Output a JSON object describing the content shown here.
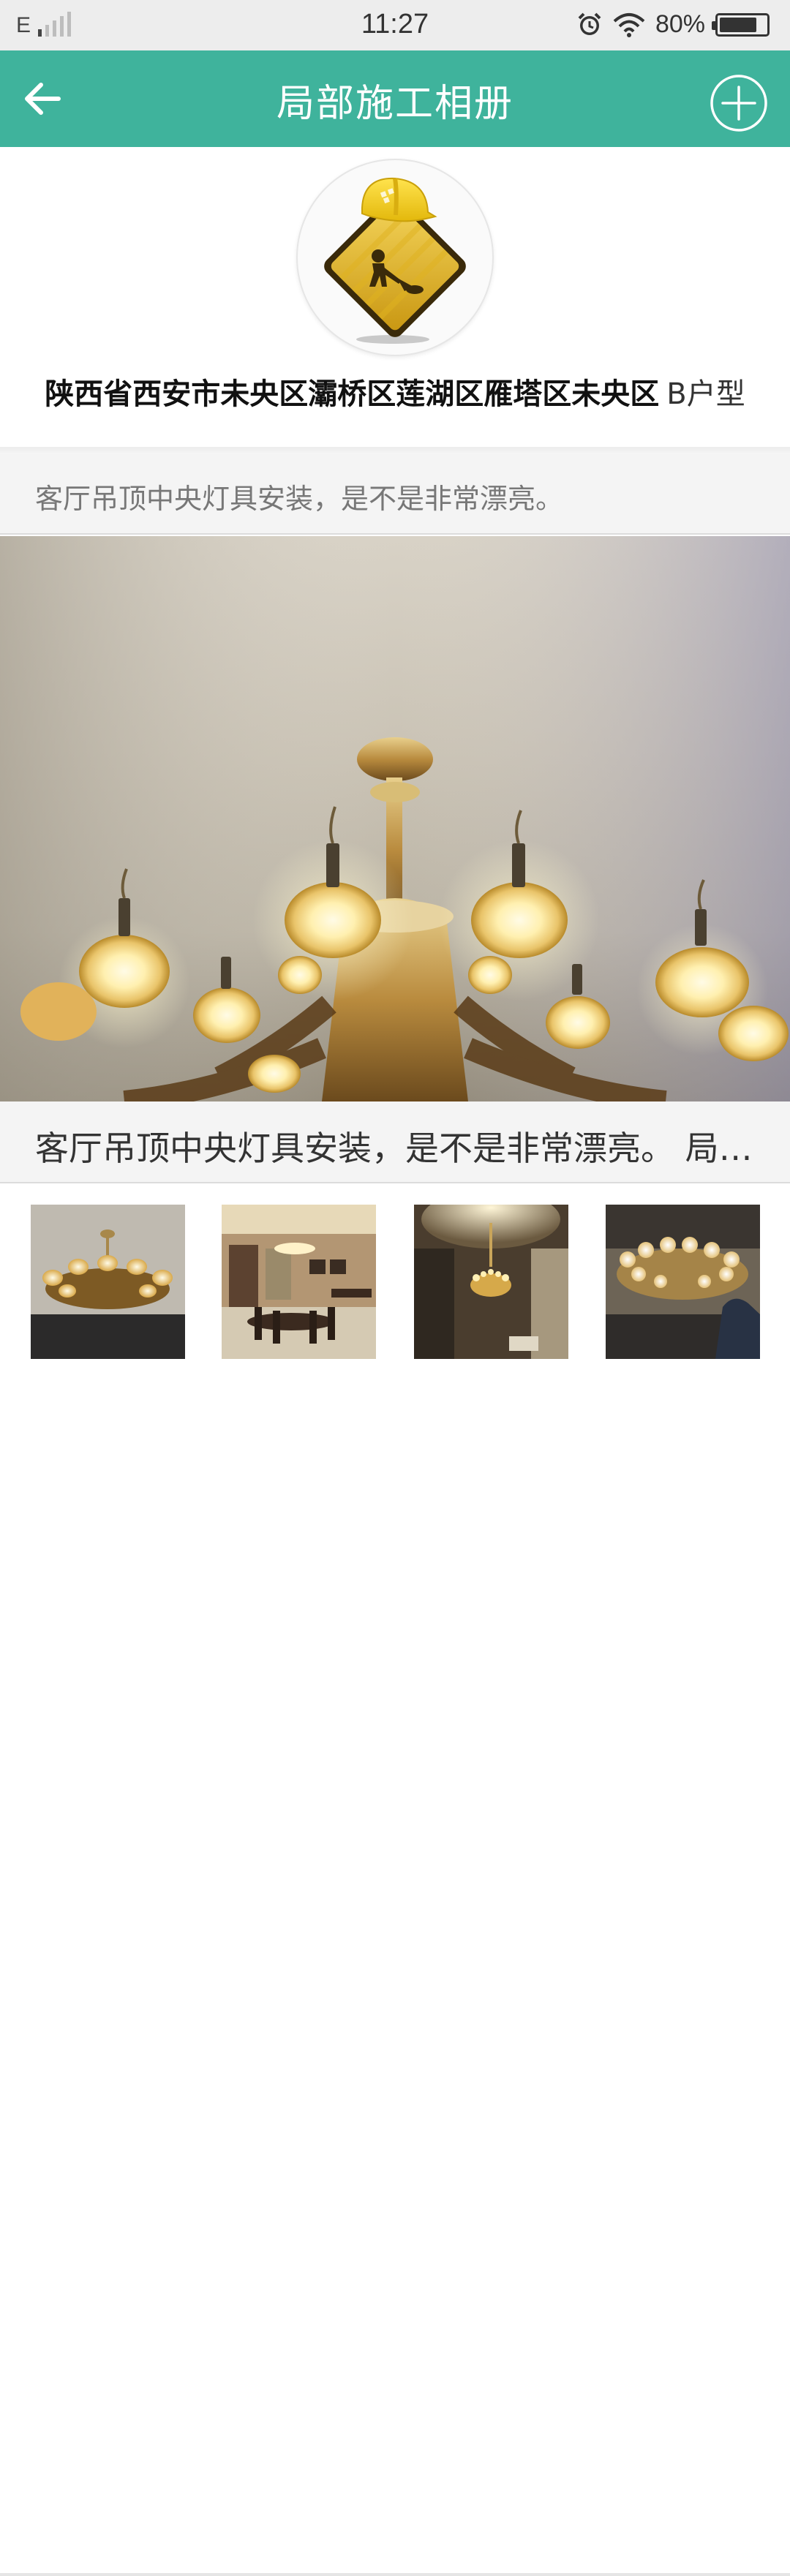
{
  "status_bar": {
    "network": "E",
    "time": "11:27",
    "battery": "80%",
    "battery_level": 0.8
  },
  "app_bar": {
    "title": "局部施工相册",
    "back_icon": "arrow-left-icon",
    "add_icon": "plus-circle-icon",
    "background_color": "#3fb39c"
  },
  "project": {
    "avatar_icon": "construction-worker-sign-icon",
    "address": "陕西省西安市未央区灞桥区莲湖区雁塔区未央区",
    "house_type": "B户型"
  },
  "album": {
    "caption": "客厅吊顶中央灯具安装，是不是非常漂亮。",
    "photo_description": "客厅吊顶中央灯具安装，是不是非常漂亮。 局部施工相册",
    "thumbnails": [
      {
        "name": "chandelier-close-up"
      },
      {
        "name": "dining-room"
      },
      {
        "name": "ceiling-lamp-wide"
      },
      {
        "name": "chandelier-installation"
      }
    ]
  }
}
